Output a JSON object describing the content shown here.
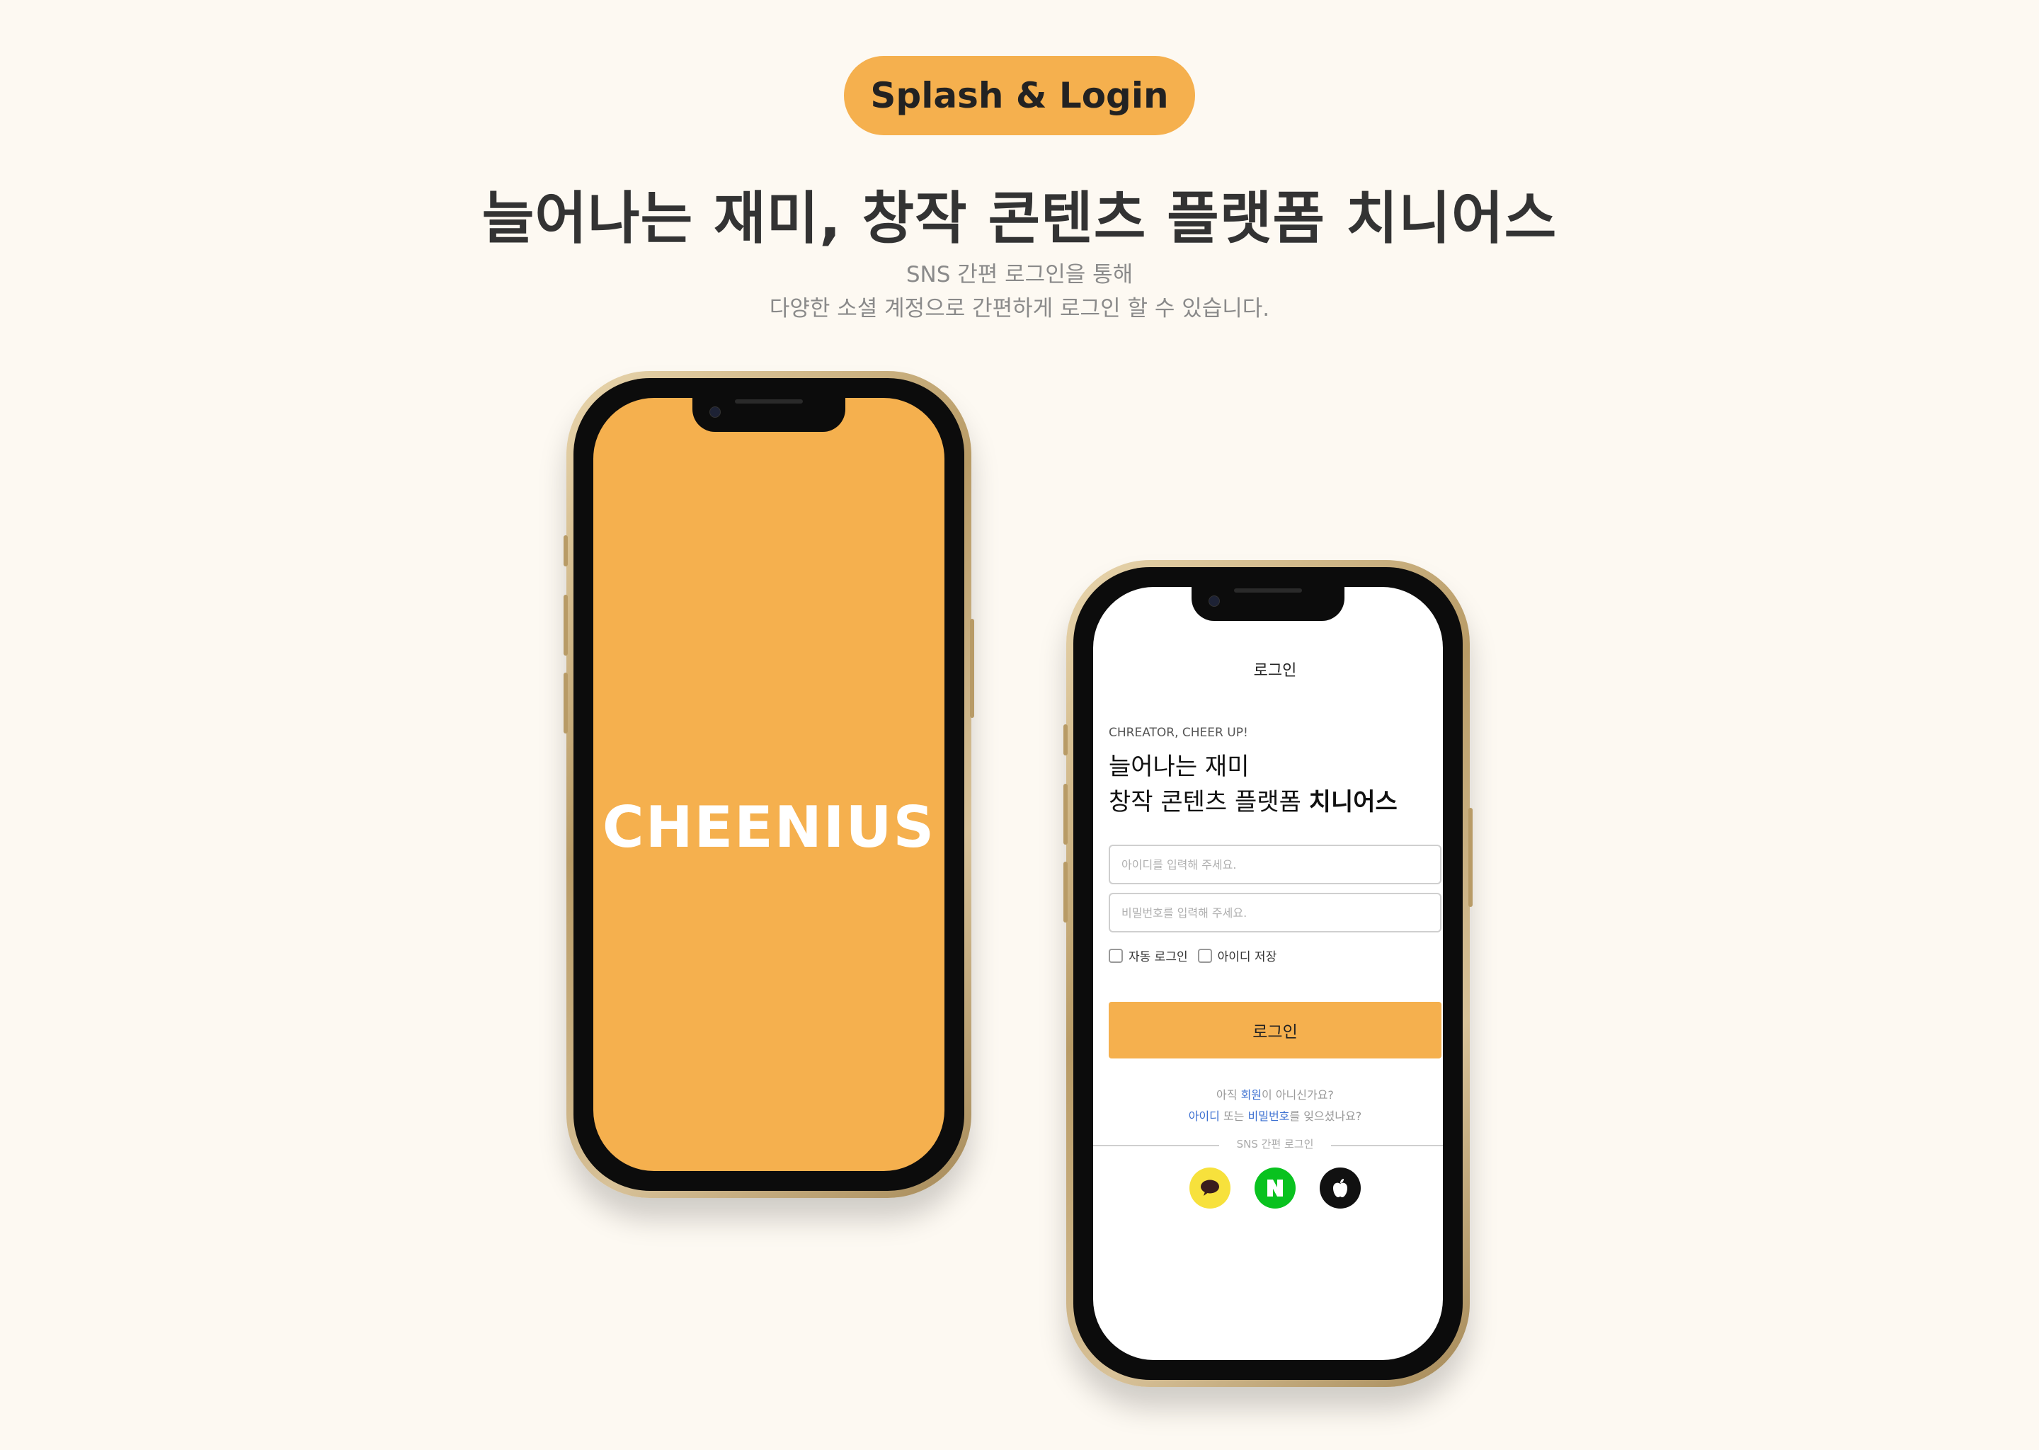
{
  "section_badge": "Splash & Login",
  "headline": "늘어나는 재미, 창작 콘텐츠 플랫폼 치니어스",
  "subtext": {
    "line1": "SNS 간편 로그인을 통해",
    "line2": "다양한 소셜 계정으로 간편하게 로그인 할 수 있습니다."
  },
  "splash": {
    "logo_text": "CHEENIUS",
    "background": "#f5b04e"
  },
  "login": {
    "nav_title": "로그인",
    "tagline": "CHREATOR, CHEER UP!",
    "intro_line1": "늘어나는 재미",
    "intro_line2_plain": "창작 콘텐츠 플랫폼 ",
    "intro_line2_bold": "치니어스",
    "id_placeholder": "아이디를 입력해 주세요.",
    "pw_placeholder": "비밀번호를 입력해 주세요.",
    "auto_login_label": "자동 로그인",
    "save_id_label": "아이디 저장",
    "login_button": "로그인",
    "help_line1_prefix": "아직 ",
    "help_line1_link": "회원",
    "help_line1_suffix": "이 아니신가요?",
    "help_line2_link1": "아이디",
    "help_line2_mid": " 또는 ",
    "help_line2_link2": "비밀번호",
    "help_line2_suffix": "를 잊으셨나요?",
    "sns_divider": "SNS 간편 로그인",
    "sns_buttons": [
      {
        "icon": "kakao-icon",
        "color": "#f7e13c"
      },
      {
        "icon": "naver-icon",
        "color": "#09c21f"
      },
      {
        "icon": "apple-icon",
        "color": "#111111"
      }
    ],
    "accent_color": "#f5b04e",
    "link_color": "#3b6fd1"
  }
}
